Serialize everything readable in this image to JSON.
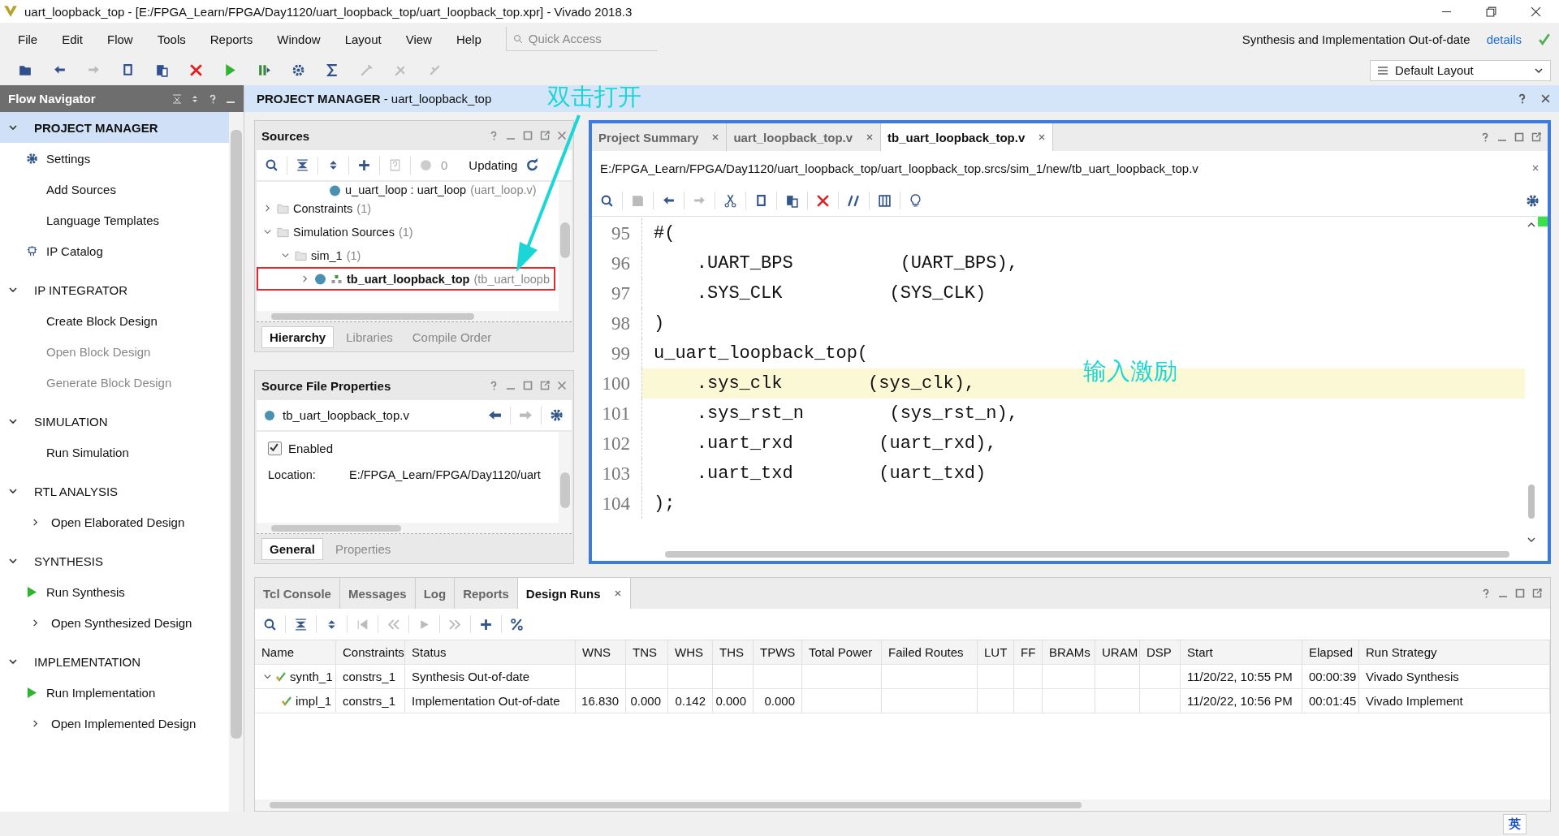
{
  "window": {
    "title": "uart_loopback_top - [E:/FPGA_Learn/FPGA/Day1120/uart_loopback_top/uart_loopback_top.xpr] - Vivado 2018.3"
  },
  "menu": [
    "File",
    "Edit",
    "Flow",
    "Tools",
    "Reports",
    "Window",
    "Layout",
    "View",
    "Help"
  ],
  "quick_access": {
    "placeholder": "Quick Access"
  },
  "status_message": "Synthesis and Implementation Out-of-date",
  "details_link": "details",
  "layout_select": {
    "value": "Default Layout"
  },
  "flow_navigator": {
    "title": "Flow Navigator",
    "sections": [
      {
        "label": "PROJECT MANAGER",
        "expanded": true,
        "selected": true,
        "items": [
          {
            "label": "Settings",
            "kind": "gear",
            "disabled": false
          },
          {
            "label": "Add Sources",
            "kind": "plain",
            "disabled": false
          },
          {
            "label": "Language Templates",
            "kind": "plain",
            "disabled": false
          },
          {
            "label": "IP Catalog",
            "kind": "chip",
            "disabled": false
          }
        ]
      },
      {
        "label": "IP INTEGRATOR",
        "expanded": true,
        "selected": false,
        "items": [
          {
            "label": "Create Block Design",
            "kind": "plain",
            "disabled": false
          },
          {
            "label": "Open Block Design",
            "kind": "plain",
            "disabled": true
          },
          {
            "label": "Generate Block Design",
            "kind": "plain",
            "disabled": true
          }
        ]
      },
      {
        "label": "SIMULATION",
        "expanded": true,
        "selected": false,
        "items": [
          {
            "label": "Run Simulation",
            "kind": "plain",
            "disabled": false
          }
        ]
      },
      {
        "label": "RTL ANALYSIS",
        "expanded": true,
        "selected": false,
        "items": [
          {
            "label": "Open Elaborated Design",
            "kind": "expandable",
            "disabled": false
          }
        ]
      },
      {
        "label": "SYNTHESIS",
        "expanded": true,
        "selected": false,
        "items": [
          {
            "label": "Run Synthesis",
            "kind": "run",
            "disabled": false
          },
          {
            "label": "Open Synthesized Design",
            "kind": "expandable",
            "disabled": false
          }
        ]
      },
      {
        "label": "IMPLEMENTATION",
        "expanded": true,
        "selected": false,
        "items": [
          {
            "label": "Run Implementation",
            "kind": "run",
            "disabled": false
          },
          {
            "label": "Open Implemented Design",
            "kind": "expandable",
            "disabled": false
          }
        ]
      }
    ]
  },
  "header": {
    "title": "**PROJECT MANAGER** - uart_loopback_top"
  },
  "sources": {
    "title": "Sources",
    "error_count": "0",
    "status": "Updating",
    "tree": [
      {
        "label": "u_uart_loop : uart_loop",
        "note": "(uart_loop.v)",
        "kind": "module"
      },
      {
        "label": "Constraints",
        "note": "(1)",
        "kind": "folder",
        "expanded": false
      },
      {
        "label": "Simulation Sources",
        "note": "(1)",
        "kind": "folder",
        "expanded": true,
        "children": [
          {
            "label": "sim_1",
            "note": "(1)",
            "kind": "folder",
            "expanded": true,
            "children": [
              {
                "label": "tb_uart_loopback_top",
                "note": "(tb_uart_loopb",
                "kind": "top",
                "expanded": false,
                "highlighted": true
              }
            ]
          }
        ]
      }
    ],
    "tabs": [
      {
        "label": "Hierarchy",
        "selected": true
      },
      {
        "label": "Libraries",
        "selected": false
      },
      {
        "label": "Compile Order",
        "selected": false
      }
    ]
  },
  "source_file_properties": {
    "title": "Source File Properties",
    "file": "tb_uart_loopback_top.v",
    "enabled": {
      "label": "Enabled",
      "checked": true
    },
    "location_label": "Location:",
    "location": "E:/FPGA_Learn/FPGA/Day1120/uart",
    "tabs": [
      {
        "label": "General",
        "selected": true
      },
      {
        "label": "Properties",
        "selected": false
      }
    ]
  },
  "editor": {
    "tabs": [
      {
        "label": "Project Summary",
        "selected": false
      },
      {
        "label": "uart_loopback_top.v",
        "selected": false
      },
      {
        "label": "tb_uart_loopback_top.v",
        "selected": true
      }
    ],
    "path": "E:/FPGA_Learn/FPGA/Day1120/uart_loopback_top/uart_loopback_top.srcs/sim_1/new/tb_uart_loopback_top.v",
    "lines": [
      {
        "number": "95",
        "code": "#(",
        "highlighted": false
      },
      {
        "number": "96",
        "code": "    .UART_BPS          (UART_BPS),",
        "highlighted": false
      },
      {
        "number": "97",
        "code": "    .SYS_CLK          (SYS_CLK)",
        "highlighted": false
      },
      {
        "number": "98",
        "code": ")",
        "highlighted": false
      },
      {
        "number": "99",
        "code": "u_uart_loopback_top(",
        "highlighted": false
      },
      {
        "number": "100",
        "code": "    .sys_clk        (sys_clk),",
        "highlighted": true
      },
      {
        "number": "101",
        "code": "    .sys_rst_n        (sys_rst_n),",
        "highlighted": false
      },
      {
        "number": "102",
        "code": "    .uart_rxd        (uart_rxd),",
        "highlighted": false
      },
      {
        "number": "103",
        "code": "    .uart_txd        (uart_txd)",
        "highlighted": false
      },
      {
        "number": "104",
        "code": ");",
        "highlighted": false
      }
    ]
  },
  "bottom_panel": {
    "tabs": [
      {
        "label": "Tcl Console",
        "selected": false
      },
      {
        "label": "Messages",
        "selected": false
      },
      {
        "label": "Log",
        "selected": false
      },
      {
        "label": "Reports",
        "selected": false
      },
      {
        "label": "Design Runs",
        "selected": true
      }
    ],
    "columns": [
      "Name",
      "Constraints",
      "Status",
      "WNS",
      "TNS",
      "WHS",
      "THS",
      "TPWS",
      "Total Power",
      "Failed Routes",
      "LUT",
      "FF",
      "BRAMs",
      "URAM",
      "DSP",
      "Start",
      "Elapsed",
      "Run Strategy"
    ],
    "rows": [
      {
        "cells": [
          "synth_1",
          "constrs_1",
          "Synthesis Out-of-date",
          "",
          "",
          "",
          "",
          "",
          "",
          "",
          "",
          "",
          "",
          "",
          "",
          "11/20/22, 10:55 PM",
          "00:00:39",
          "Vivado Synthesis"
        ],
        "expanded": true,
        "children": [
          {
            "cells": [
              "impl_1",
              "constrs_1",
              "Implementation Out-of-date",
              "16.830",
              "0.000",
              "0.142",
              "0.000",
              "0.000",
              "",
              "",
              "",
              "",
              "",
              "",
              "",
              "11/20/22, 10:56 PM",
              "00:01:45",
              "Vivado Implement"
            ]
          }
        ]
      }
    ]
  },
  "annotations": [
    "双击打开",
    "输入激励"
  ],
  "ime_bar": {
    "label": "英"
  }
}
